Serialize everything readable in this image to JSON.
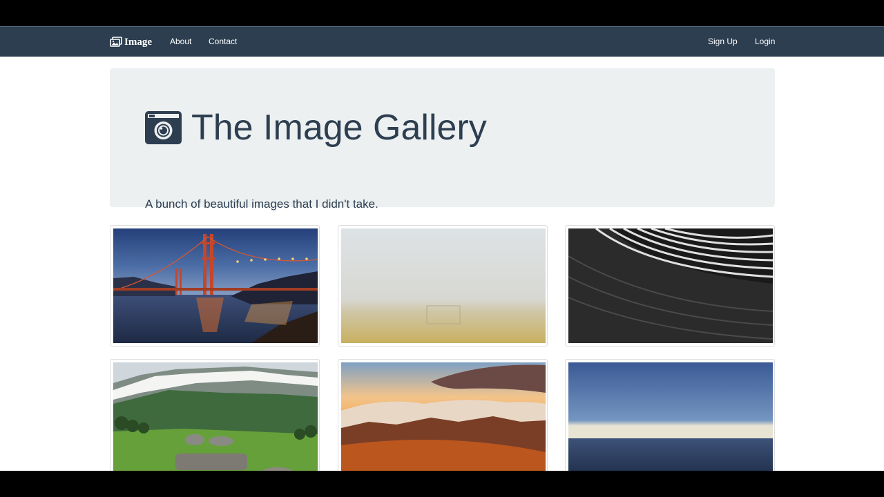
{
  "navbar": {
    "brand": "Image",
    "links": [
      "About",
      "Contact"
    ],
    "right_links": [
      "Sign Up",
      "Login"
    ],
    "background": "#2c3e50"
  },
  "jumbotron": {
    "icon": "camera-icon",
    "title": "The Image Gallery",
    "subtitle": "A bunch of beautiful images that I didn't take.",
    "background": "#ecf0f1"
  },
  "gallery": {
    "images": [
      "golden-gate-bridge-night",
      "foggy-soccer-field",
      "abstract-black-white-architecture",
      "green-mountain-valley",
      "sunset-clouds-over-mountains",
      "blue-sky-over-ocean-horizon"
    ]
  }
}
